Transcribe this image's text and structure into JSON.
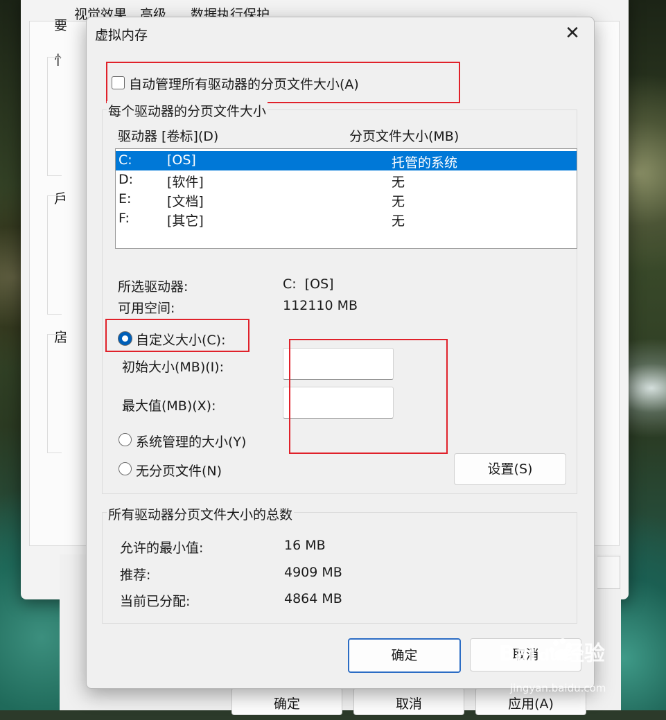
{
  "back_window": {
    "tabs": [
      "视觉效果",
      "高级",
      "数据执行保护"
    ],
    "side_chars": [
      "要",
      "性",
      "虚",
      "虚"
    ],
    "side_chars_visible": [
      "要",
      "忄",
      "戶",
      "扂"
    ],
    "buttons": {
      "ok": "确定",
      "cancel": "取消",
      "apply": "应用(A)"
    }
  },
  "dialog": {
    "title": "虚拟内存",
    "auto_manage_label": "自动管理所有驱动器的分页文件大小(A)",
    "auto_manage_checked": false,
    "per_drive_group": {
      "legend": "每个驱动器的分页文件大小",
      "columns": {
        "drive": "驱动器 [卷标](D)",
        "size": "分页文件大小(MB)"
      },
      "drives": [
        {
          "letter": "C:",
          "label": "[OS]",
          "size": "托管的系统",
          "selected": true
        },
        {
          "letter": "D:",
          "label": "[软件]",
          "size": "无",
          "selected": false
        },
        {
          "letter": "E:",
          "label": "[文档]",
          "size": "无",
          "selected": false
        },
        {
          "letter": "F:",
          "label": "[其它]",
          "size": "无",
          "selected": false
        }
      ],
      "selected_drive_label": "所选驱动器:",
      "selected_drive_value": "C:  [OS]",
      "free_space_label": "可用空间:",
      "free_space_value": "112110 MB",
      "custom_size_label": "自定义大小(C):",
      "initial_size_label": "初始大小(MB)(I):",
      "initial_size_value": "",
      "max_size_label": "最大值(MB)(X):",
      "max_size_value": "",
      "system_managed_label": "系统管理的大小(Y)",
      "no_paging_label": "无分页文件(N)",
      "set_button": "设置(S)",
      "selected_option": "custom"
    },
    "totals_group": {
      "legend": "所有驱动器分页文件大小的总数",
      "min_label": "允许的最小值:",
      "min_value": "16 MB",
      "recommended_label": "推荐:",
      "recommended_value": "4909 MB",
      "allocated_label": "当前已分配:",
      "allocated_value": "4864 MB"
    },
    "ok_button": "确定",
    "cancel_button": "取消"
  },
  "watermark": {
    "brand": "Bai",
    "brand2": "经验",
    "url": "jingyan.baidu.com"
  },
  "colors": {
    "accent": "#0078d7",
    "highlight_box": "#e0212a"
  }
}
